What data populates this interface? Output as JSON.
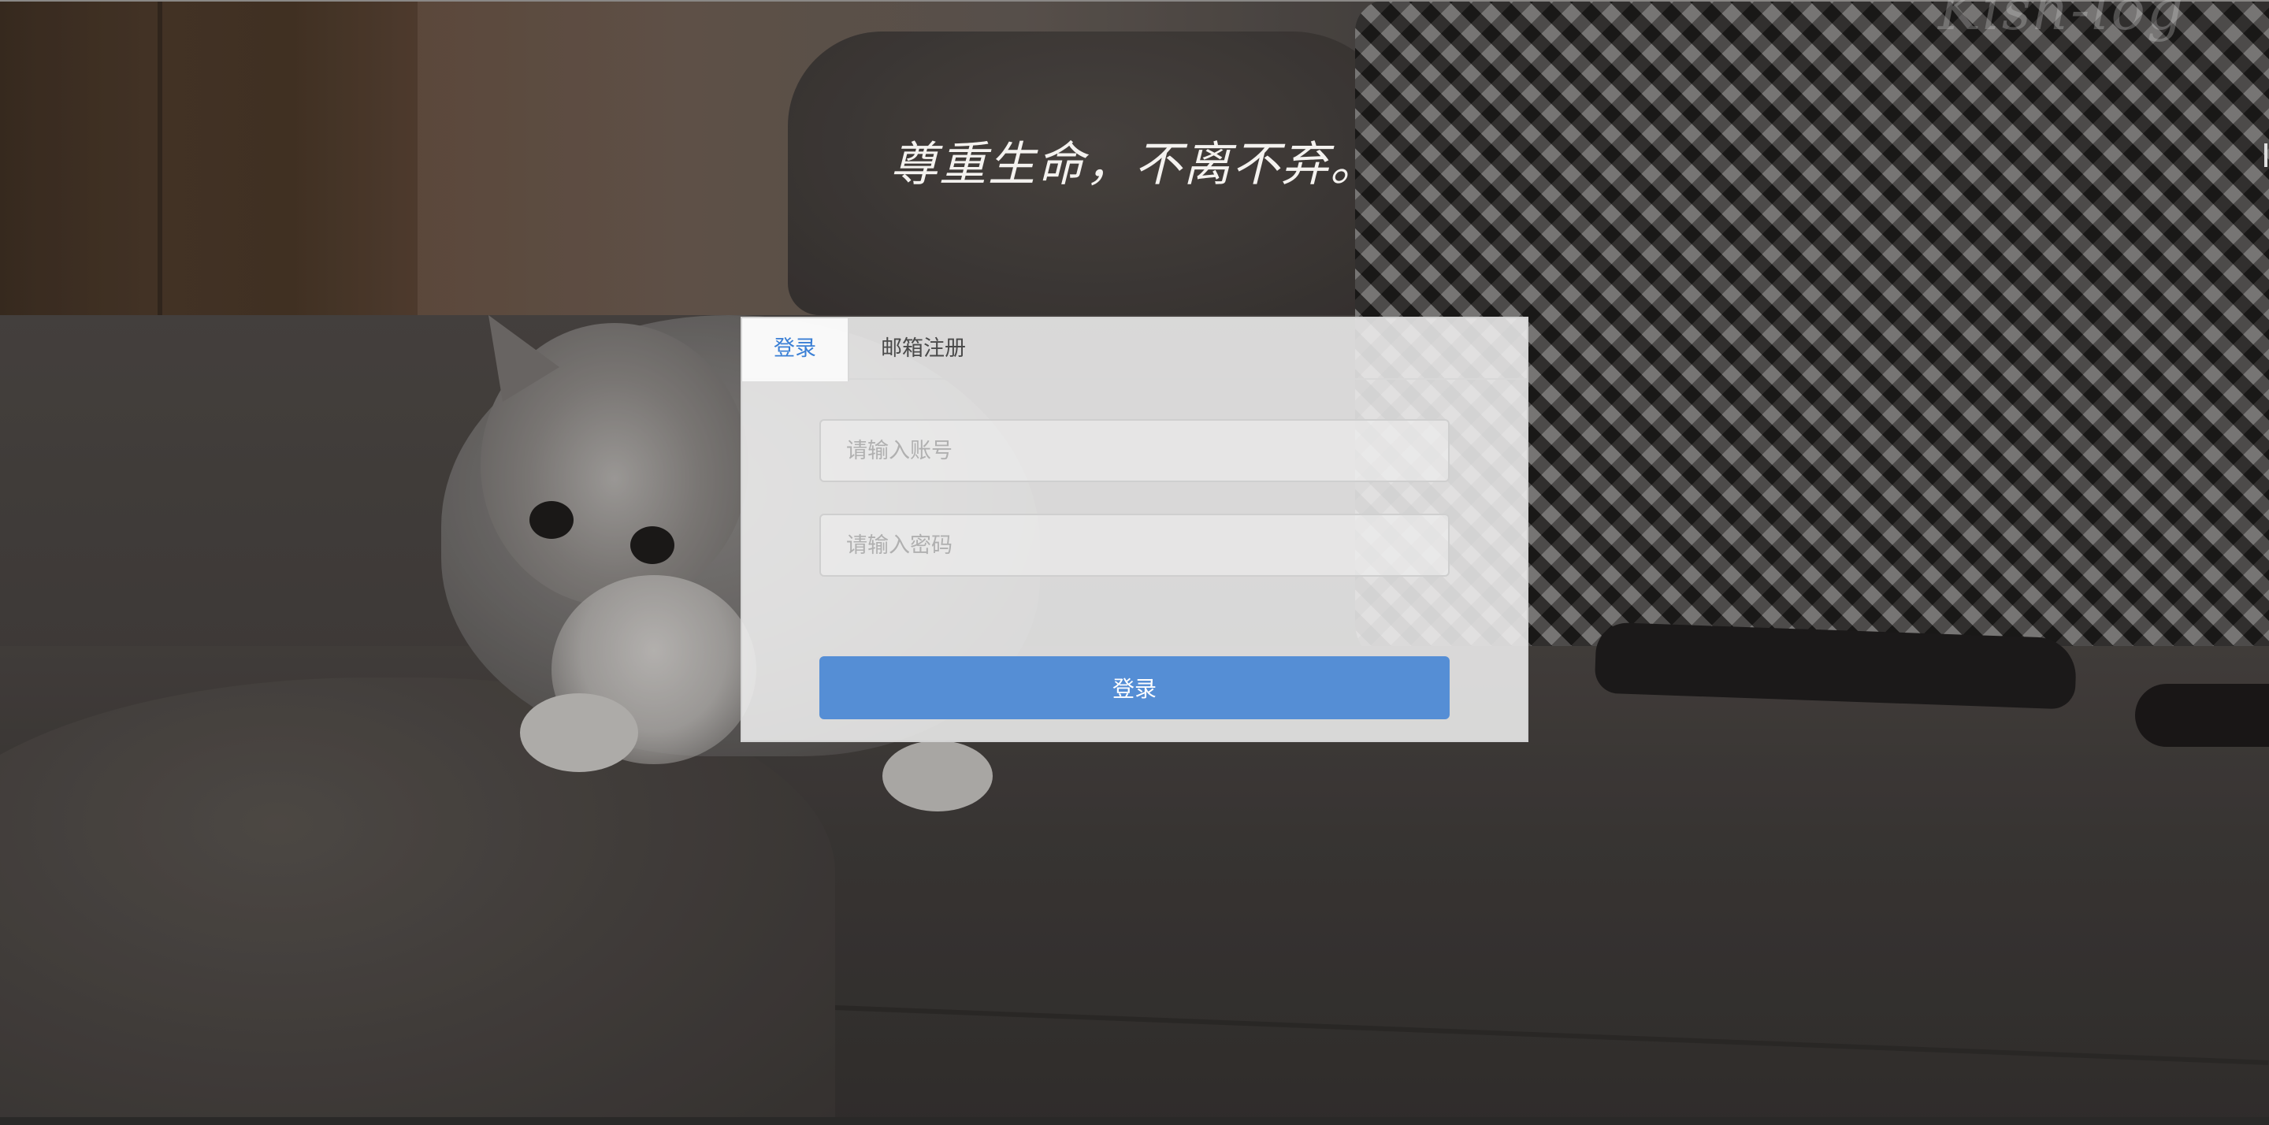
{
  "watermark": "Kish-log",
  "slogan": "尊重生命，不离不弃。",
  "login_card": {
    "tabs": [
      {
        "label": "登录",
        "active": true
      },
      {
        "label": "邮箱注册",
        "active": false
      }
    ],
    "account_placeholder": "请输入账号",
    "password_placeholder": "请输入密码",
    "submit_label": "登录"
  },
  "colors": {
    "accent": "#558ed5",
    "active_tab": "#3a7fd5"
  }
}
